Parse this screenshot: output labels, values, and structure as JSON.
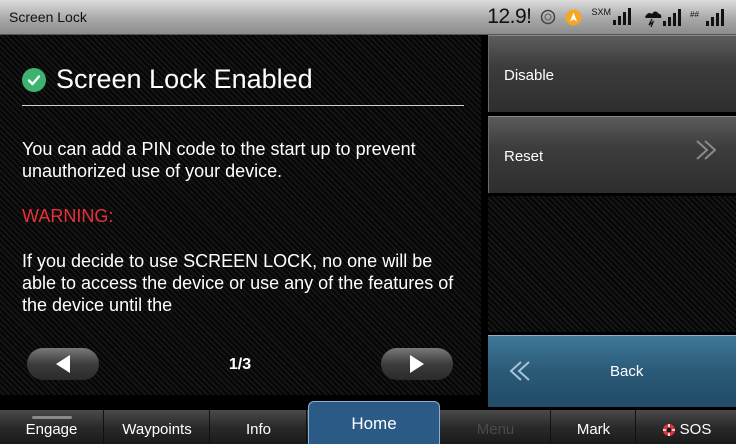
{
  "statusbar": {
    "title": "Screen Lock",
    "clock": "12.9!",
    "icons": [
      "compass-icon",
      "alert-badge-icon",
      "sxm-signal-icon",
      "weather-signal-icon",
      "cellular-signal-icon"
    ],
    "sxm_label": "SXM"
  },
  "content": {
    "heading": "Screen Lock Enabled",
    "paragraph1": "You can add a PIN code to the start up to prevent unauthorized use of your device.",
    "warning": "WARNING:",
    "paragraph2": "If you decide to use SCREEN LOCK, no one will be able to access the device or use any of the features of the device until the",
    "pager": "1/3"
  },
  "side": {
    "disable": "Disable",
    "reset": "Reset",
    "back": "Back"
  },
  "nav": {
    "engage": "Engage",
    "waypoints": "Waypoints",
    "info": "Info",
    "home": "Home",
    "menu": "Menu",
    "mark": "Mark",
    "sos": "SOS"
  },
  "colors": {
    "accent": "#2c5a86",
    "warning": "#e8303a",
    "success": "#3cb371",
    "back_button": "#2a5a78"
  }
}
